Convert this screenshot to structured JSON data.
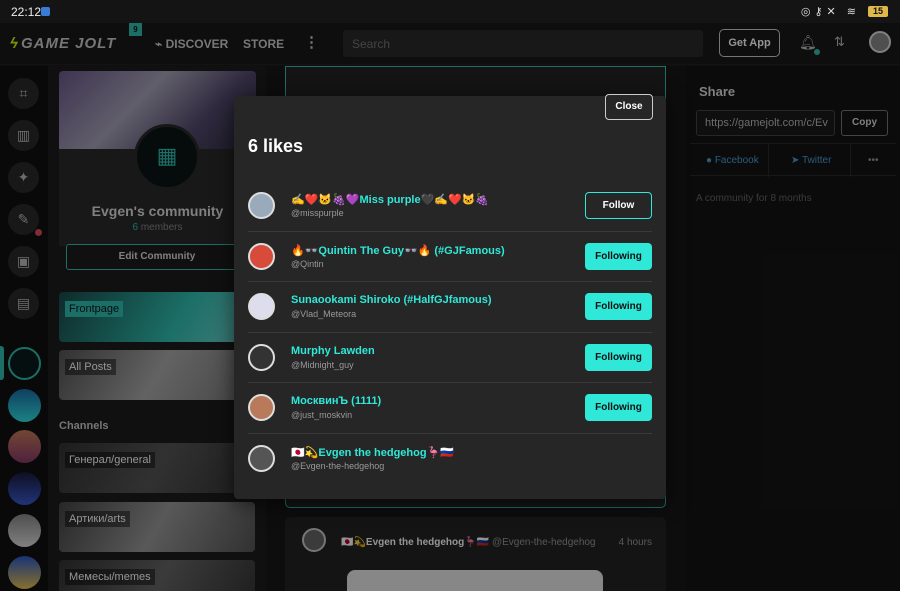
{
  "status_bar": {
    "time": "22:12",
    "battery": "15"
  },
  "nav": {
    "logo": "GAME JOLT",
    "logo_badge": "9",
    "discover": "DISCOVER",
    "store": "STORE",
    "more": "⋮",
    "search_placeholder": "Search",
    "get_app": "Get App"
  },
  "community": {
    "name": "Evgen's community",
    "members_count": "6",
    "members_label": "members",
    "edit_button": "Edit Community",
    "frontpage": "Frontpage",
    "all_posts": "All Posts",
    "channels_heading": "Channels",
    "channels": [
      "Генерал/general",
      "Артики/arts",
      "Мемесы/memes"
    ]
  },
  "post": {
    "author": "🇯🇵💫Evgen the hedgehog🦩🇷🇺",
    "handle": "@Evgen-the-hedgehog",
    "time": "4 hours"
  },
  "share": {
    "heading": "Share",
    "url": "https://gamejolt.com/c/Ev",
    "copy": "Copy",
    "facebook": "Facebook",
    "twitter": "Twitter",
    "more": "•••",
    "age": "A community for 8 months"
  },
  "modal": {
    "close": "Close",
    "title": "6 likes",
    "likes": [
      {
        "name": "✍️❤️🐱🍇💜Miss purple🖤✍️❤️🐱🍇",
        "handle": "@misspurple",
        "button": "Follow",
        "state": "follow"
      },
      {
        "name": "🔥👓Quintin The Guy👓🔥 (#GJFamous)",
        "handle": "@Qintin",
        "button": "Following",
        "state": "following"
      },
      {
        "name": "Sunaookami Shiroko (#HalfGJfamous)",
        "handle": "@Vlad_Meteora",
        "button": "Following",
        "state": "following"
      },
      {
        "name": "Murphy Lawden",
        "handle": "@Midnight_guy",
        "button": "Following",
        "state": "following"
      },
      {
        "name": "МосквинЪ (1111)",
        "handle": "@just_moskvin",
        "button": "Following",
        "state": "following"
      },
      {
        "name": "🇯🇵💫Evgen the hedgehog🦩🇷🇺",
        "handle": "@Evgen-the-hedgehog",
        "button": "",
        "state": "none"
      }
    ]
  },
  "colors": {
    "accent": "#2fe8d8",
    "teal": "#2fbfb0",
    "logo": "#ccff00"
  }
}
